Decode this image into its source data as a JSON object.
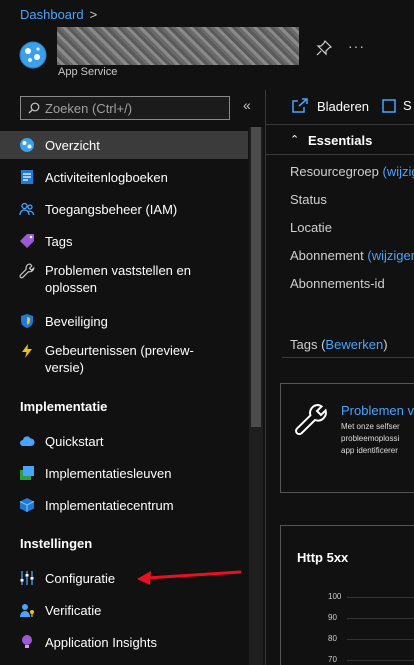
{
  "breadcrumb": {
    "root": "Dashboard",
    "separator": ">"
  },
  "resource": {
    "type": "App Service"
  },
  "search": {
    "placeholder": "Zoeken (Ctrl+/)"
  },
  "collapse_label": "«",
  "more_label": "···",
  "nav": {
    "items": [
      {
        "label": "Overzicht",
        "icon": "globe-icon",
        "active": true
      },
      {
        "label": "Activiteitenlogboeken",
        "icon": "log-icon"
      },
      {
        "label": "Toegangsbeheer (IAM)",
        "icon": "users-icon"
      },
      {
        "label": "Tags",
        "icon": "tag-icon"
      },
      {
        "label": "Problemen vaststellen en oplossen",
        "icon": "wrench-icon"
      },
      {
        "label": "Beveiliging",
        "icon": "shield-icon"
      },
      {
        "label": "Gebeurtenissen (preview-versie)",
        "icon": "lightning-icon"
      }
    ],
    "section_deploy": "Implementatie",
    "deploy_items": [
      {
        "label": "Quickstart",
        "icon": "cloud-icon"
      },
      {
        "label": "Implementatiesleuven",
        "icon": "slots-icon"
      },
      {
        "label": "Implementatiecentrum",
        "icon": "cube-icon"
      }
    ],
    "section_settings": "Instellingen",
    "settings_items": [
      {
        "label": "Configuratie",
        "icon": "sliders-icon"
      },
      {
        "label": "Verificatie",
        "icon": "user-key-icon"
      },
      {
        "label": "Application Insights",
        "icon": "bulb-icon"
      }
    ]
  },
  "commands": {
    "browse": "Bladeren",
    "stop_partial": "S"
  },
  "essentials": {
    "title": "Essentials",
    "resource_group_label": "Resourcegroep",
    "resource_group_link": "(wijzig",
    "status_label": "Status",
    "location_label": "Locatie",
    "subscription_label": "Abonnement",
    "subscription_link": "(wijziger",
    "subscription_id_label": "Abonnements-id"
  },
  "tags": {
    "label": "Tags",
    "link": "Bewerken"
  },
  "diagnose_card": {
    "title": "Problemen v",
    "desc_lines": [
      "Met onze selfser",
      "probleemoplossi",
      "app identificerer"
    ]
  },
  "chart_card": {
    "title": "Http 5xx",
    "ticks": [
      "100",
      "90",
      "80",
      "70"
    ]
  },
  "colors": {
    "accent": "#4aa3ff",
    "annotation_arrow": "#e81123",
    "active_bg": "#3b3b3b"
  }
}
